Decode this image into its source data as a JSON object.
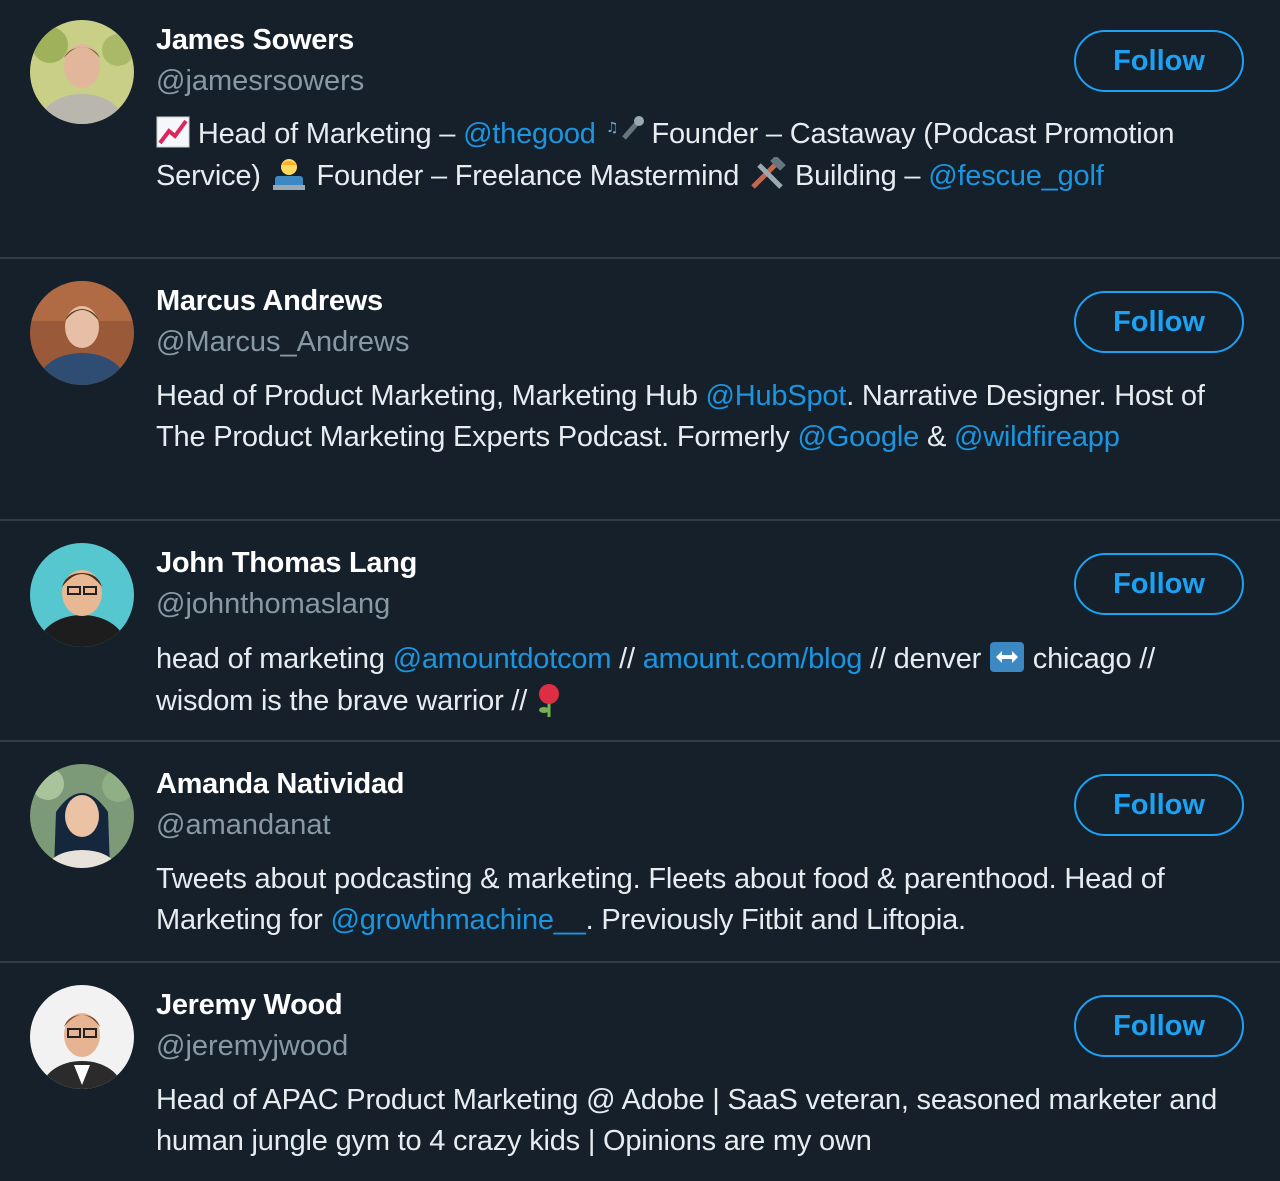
{
  "colors": {
    "background": "#15202b",
    "accent": "#1da1f2",
    "mention": "#1b95e0",
    "muted": "#8899a6"
  },
  "users": [
    {
      "name": "James Sowers",
      "handle": "@jamesrsowers",
      "follow_label": "Follow",
      "bio": {
        "t1": "Head of Marketing – ",
        "m1": "@thegood",
        "t2": " Founder – Castaway (Podcast Promotion Service) ",
        "t3": " Founder – Freelance Mastermind ",
        "t4": " Building – ",
        "m2": "@fescue_golf"
      },
      "icons": [
        "chart-increasing-emoji",
        "microphone-emoji",
        "technologist-emoji",
        "hammer-and-wrench-emoji"
      ]
    },
    {
      "name": "Marcus Andrews",
      "handle": "@Marcus_Andrews",
      "follow_label": "Follow",
      "bio": {
        "t1": "Head of Product Marketing, Marketing Hub ",
        "m1": "@HubSpot",
        "t2": ". Narrative Designer. Host of The Product Marketing Experts Podcast. Formerly ",
        "m2": "@Google",
        "t3": " & ",
        "m3": "@wildfireapp"
      }
    },
    {
      "name": "John Thomas Lang",
      "handle": "@johnthomaslang",
      "follow_label": "Follow",
      "bio": {
        "t1": "head of marketing ",
        "m1": "@amountdotcom",
        "t2": " // ",
        "m2": "amount.com/blog",
        "t3": " // denver ",
        "t4": " chicago // wisdom is the brave warrior // "
      },
      "icons": [
        "left-right-arrow-emoji",
        "rose-emoji"
      ]
    },
    {
      "name": "Amanda Natividad",
      "handle": "@amandanat",
      "follow_label": "Follow",
      "bio": {
        "t1": "Tweets about podcasting & marketing. Fleets about food & parenthood. Head of Marketing for ",
        "m1": "@growthmachine__",
        "t2": ". Previously Fitbit and Liftopia."
      }
    },
    {
      "name": "Jeremy Wood",
      "handle": "@jeremyjwood",
      "follow_label": "Follow",
      "bio": {
        "t1": "Head of APAC Product Marketing @ Adobe | SaaS veteran, seasoned marketer and human jungle gym to 4 crazy kids | Opinions are my own"
      }
    }
  ]
}
